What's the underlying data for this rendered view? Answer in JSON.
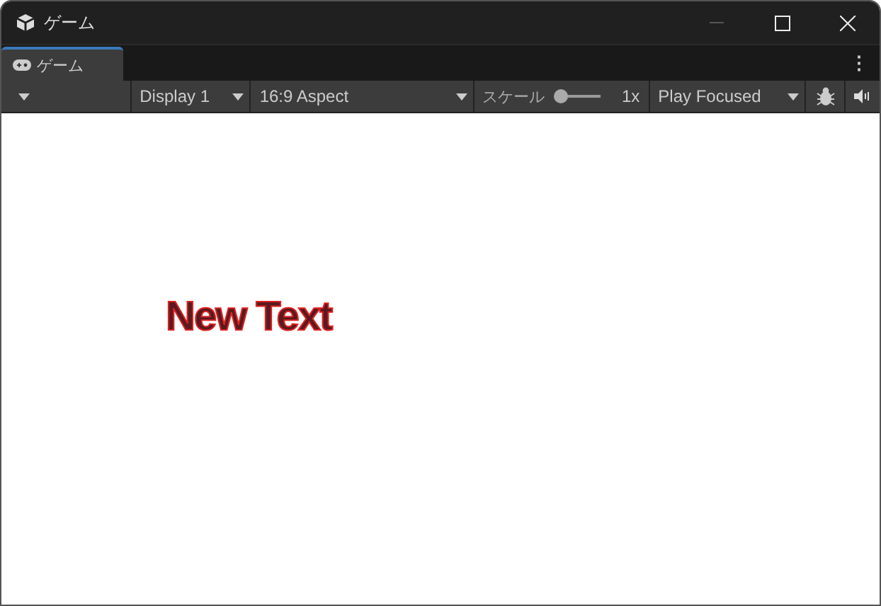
{
  "window": {
    "title": "ゲーム",
    "minimize_disabled": true
  },
  "tabs": [
    {
      "label": "ゲーム",
      "selected": true
    }
  ],
  "tab_bar": {
    "menu_glyph": "⋮"
  },
  "toolbar": {
    "display": "Display 1",
    "aspect": "16:9 Aspect",
    "scale_label": "スケール",
    "scale": {
      "level": 0
    },
    "scale_reading": "1x",
    "play_mode": "Play Focused"
  },
  "game_view": {
    "text": "New Text"
  }
}
